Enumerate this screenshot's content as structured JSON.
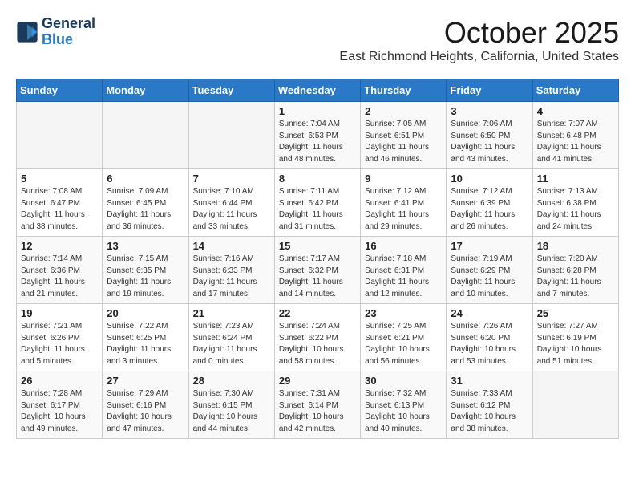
{
  "logo": {
    "line1": "General",
    "line2": "Blue"
  },
  "title": "October 2025",
  "location": "East Richmond Heights, California, United States",
  "weekdays": [
    "Sunday",
    "Monday",
    "Tuesday",
    "Wednesday",
    "Thursday",
    "Friday",
    "Saturday"
  ],
  "weeks": [
    [
      {
        "day": "",
        "info": ""
      },
      {
        "day": "",
        "info": ""
      },
      {
        "day": "",
        "info": ""
      },
      {
        "day": "1",
        "info": "Sunrise: 7:04 AM\nSunset: 6:53 PM\nDaylight: 11 hours and 48 minutes."
      },
      {
        "day": "2",
        "info": "Sunrise: 7:05 AM\nSunset: 6:51 PM\nDaylight: 11 hours and 46 minutes."
      },
      {
        "day": "3",
        "info": "Sunrise: 7:06 AM\nSunset: 6:50 PM\nDaylight: 11 hours and 43 minutes."
      },
      {
        "day": "4",
        "info": "Sunrise: 7:07 AM\nSunset: 6:48 PM\nDaylight: 11 hours and 41 minutes."
      }
    ],
    [
      {
        "day": "5",
        "info": "Sunrise: 7:08 AM\nSunset: 6:47 PM\nDaylight: 11 hours and 38 minutes."
      },
      {
        "day": "6",
        "info": "Sunrise: 7:09 AM\nSunset: 6:45 PM\nDaylight: 11 hours and 36 minutes."
      },
      {
        "day": "7",
        "info": "Sunrise: 7:10 AM\nSunset: 6:44 PM\nDaylight: 11 hours and 33 minutes."
      },
      {
        "day": "8",
        "info": "Sunrise: 7:11 AM\nSunset: 6:42 PM\nDaylight: 11 hours and 31 minutes."
      },
      {
        "day": "9",
        "info": "Sunrise: 7:12 AM\nSunset: 6:41 PM\nDaylight: 11 hours and 29 minutes."
      },
      {
        "day": "10",
        "info": "Sunrise: 7:12 AM\nSunset: 6:39 PM\nDaylight: 11 hours and 26 minutes."
      },
      {
        "day": "11",
        "info": "Sunrise: 7:13 AM\nSunset: 6:38 PM\nDaylight: 11 hours and 24 minutes."
      }
    ],
    [
      {
        "day": "12",
        "info": "Sunrise: 7:14 AM\nSunset: 6:36 PM\nDaylight: 11 hours and 21 minutes."
      },
      {
        "day": "13",
        "info": "Sunrise: 7:15 AM\nSunset: 6:35 PM\nDaylight: 11 hours and 19 minutes."
      },
      {
        "day": "14",
        "info": "Sunrise: 7:16 AM\nSunset: 6:33 PM\nDaylight: 11 hours and 17 minutes."
      },
      {
        "day": "15",
        "info": "Sunrise: 7:17 AM\nSunset: 6:32 PM\nDaylight: 11 hours and 14 minutes."
      },
      {
        "day": "16",
        "info": "Sunrise: 7:18 AM\nSunset: 6:31 PM\nDaylight: 11 hours and 12 minutes."
      },
      {
        "day": "17",
        "info": "Sunrise: 7:19 AM\nSunset: 6:29 PM\nDaylight: 11 hours and 10 minutes."
      },
      {
        "day": "18",
        "info": "Sunrise: 7:20 AM\nSunset: 6:28 PM\nDaylight: 11 hours and 7 minutes."
      }
    ],
    [
      {
        "day": "19",
        "info": "Sunrise: 7:21 AM\nSunset: 6:26 PM\nDaylight: 11 hours and 5 minutes."
      },
      {
        "day": "20",
        "info": "Sunrise: 7:22 AM\nSunset: 6:25 PM\nDaylight: 11 hours and 3 minutes."
      },
      {
        "day": "21",
        "info": "Sunrise: 7:23 AM\nSunset: 6:24 PM\nDaylight: 11 hours and 0 minutes."
      },
      {
        "day": "22",
        "info": "Sunrise: 7:24 AM\nSunset: 6:22 PM\nDaylight: 10 hours and 58 minutes."
      },
      {
        "day": "23",
        "info": "Sunrise: 7:25 AM\nSunset: 6:21 PM\nDaylight: 10 hours and 56 minutes."
      },
      {
        "day": "24",
        "info": "Sunrise: 7:26 AM\nSunset: 6:20 PM\nDaylight: 10 hours and 53 minutes."
      },
      {
        "day": "25",
        "info": "Sunrise: 7:27 AM\nSunset: 6:19 PM\nDaylight: 10 hours and 51 minutes."
      }
    ],
    [
      {
        "day": "26",
        "info": "Sunrise: 7:28 AM\nSunset: 6:17 PM\nDaylight: 10 hours and 49 minutes."
      },
      {
        "day": "27",
        "info": "Sunrise: 7:29 AM\nSunset: 6:16 PM\nDaylight: 10 hours and 47 minutes."
      },
      {
        "day": "28",
        "info": "Sunrise: 7:30 AM\nSunset: 6:15 PM\nDaylight: 10 hours and 44 minutes."
      },
      {
        "day": "29",
        "info": "Sunrise: 7:31 AM\nSunset: 6:14 PM\nDaylight: 10 hours and 42 minutes."
      },
      {
        "day": "30",
        "info": "Sunrise: 7:32 AM\nSunset: 6:13 PM\nDaylight: 10 hours and 40 minutes."
      },
      {
        "day": "31",
        "info": "Sunrise: 7:33 AM\nSunset: 6:12 PM\nDaylight: 10 hours and 38 minutes."
      },
      {
        "day": "",
        "info": ""
      }
    ]
  ]
}
